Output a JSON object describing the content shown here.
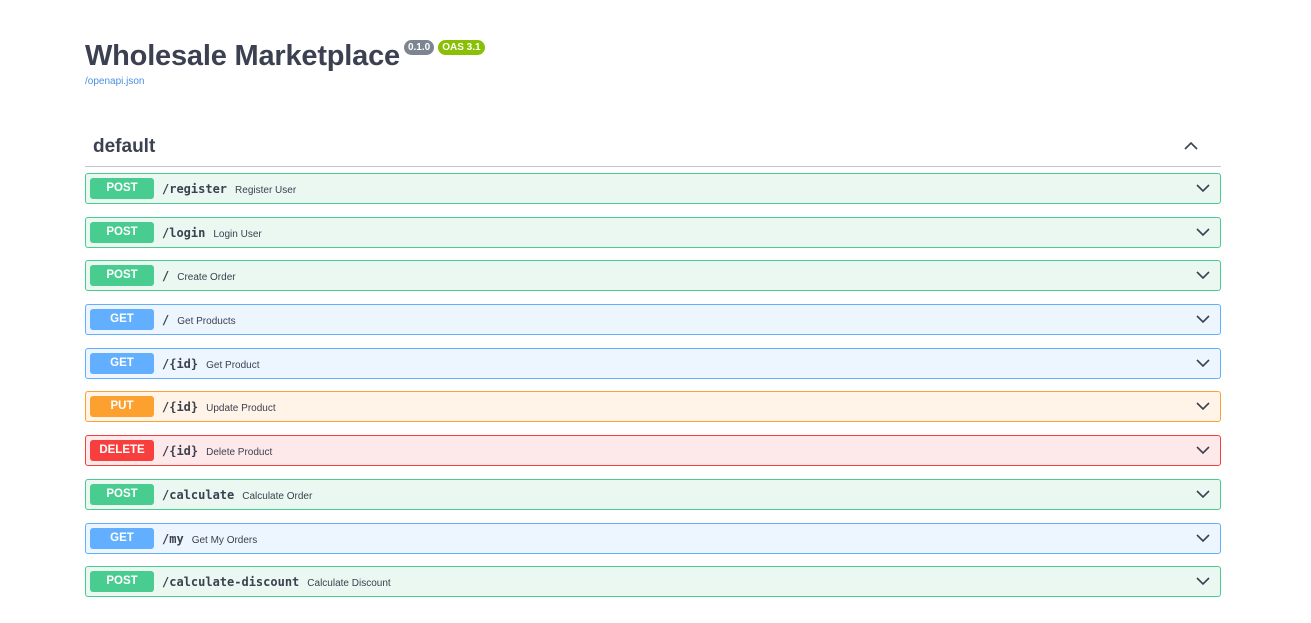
{
  "info": {
    "title": "Wholesale Marketplace",
    "version": "0.1.0",
    "oas": "OAS 3.1",
    "spec_link": "/openapi.json"
  },
  "tag": {
    "name": "default"
  },
  "operations": [
    {
      "method": "POST",
      "path": "/register",
      "summary": "Register User"
    },
    {
      "method": "POST",
      "path": "/login",
      "summary": "Login User"
    },
    {
      "method": "POST",
      "path": "/",
      "summary": "Create Order"
    },
    {
      "method": "GET",
      "path": "/",
      "summary": "Get Products"
    },
    {
      "method": "GET",
      "path": "/{id}",
      "summary": "Get Product"
    },
    {
      "method": "PUT",
      "path": "/{id}",
      "summary": "Update Product"
    },
    {
      "method": "DELETE",
      "path": "/{id}",
      "summary": "Delete Product"
    },
    {
      "method": "POST",
      "path": "/calculate",
      "summary": "Calculate Order"
    },
    {
      "method": "GET",
      "path": "/my",
      "summary": "Get My Orders"
    },
    {
      "method": "POST",
      "path": "/calculate-discount",
      "summary": "Calculate Discount"
    }
  ],
  "icons": {
    "tag_toggle": "chevron-up-icon",
    "op_toggle": "chevron-down-icon"
  },
  "colors": {
    "post": "#49cc90",
    "get": "#61affe",
    "put": "#fca130",
    "delete": "#f93e3e"
  }
}
